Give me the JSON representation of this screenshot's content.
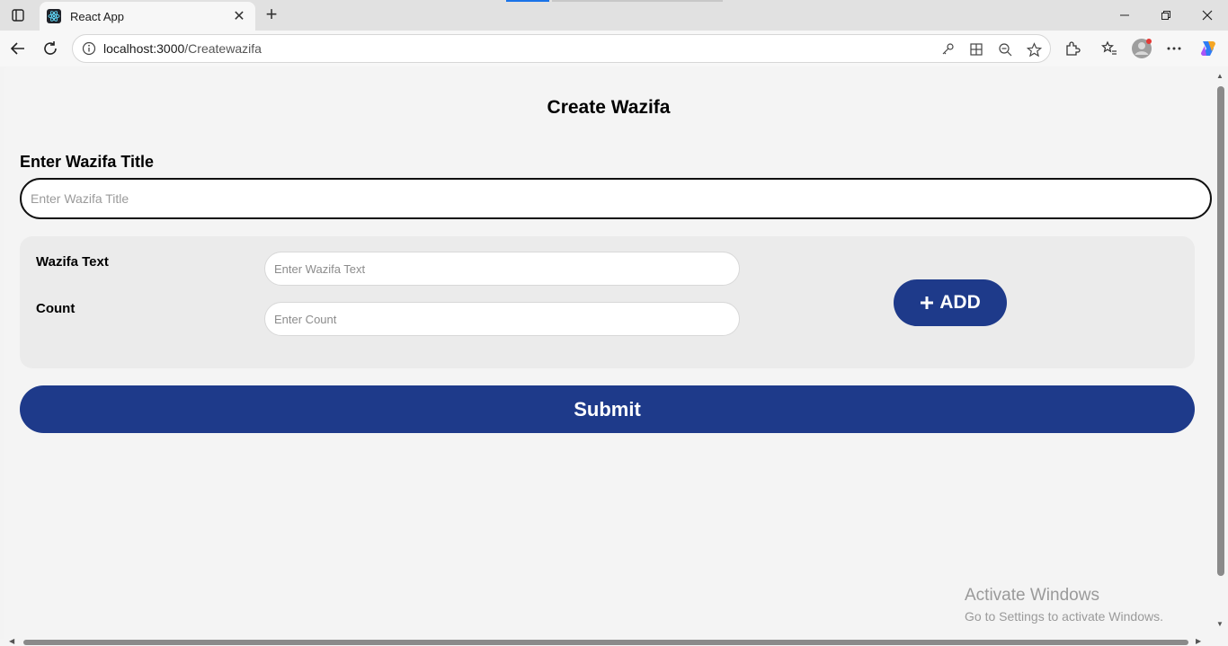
{
  "browser": {
    "tab_title": "React App",
    "tab_close": "✕",
    "new_tab": "+",
    "url_host": "localhost:3000",
    "url_path": "/Createwazifa"
  },
  "page": {
    "title": "Create Wazifa",
    "title_label": "Enter Wazifa Title",
    "title_placeholder": "Enter Wazifa Title",
    "text_label": "Wazifa Text",
    "text_placeholder": "Enter Wazifa Text",
    "count_label": "Count",
    "count_placeholder": "Enter Count",
    "add_label": "ADD",
    "submit_label": "Submit"
  },
  "watermark": {
    "line1": "Activate Windows",
    "line2": "Go to Settings to activate Windows."
  },
  "colors": {
    "accent": "#1e3a8a"
  }
}
